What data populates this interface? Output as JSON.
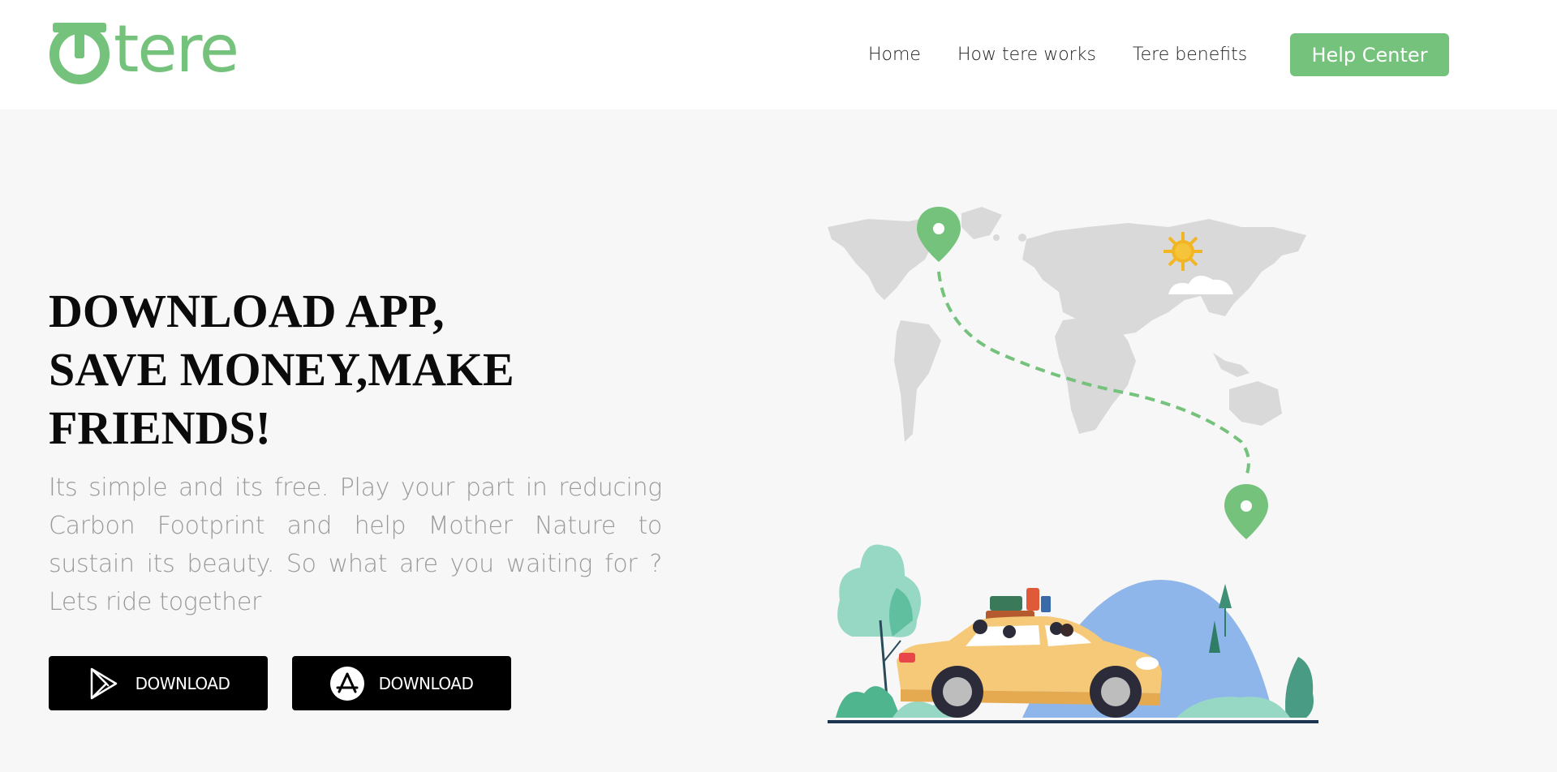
{
  "brand": {
    "name": "tere",
    "accent": "#74c27b"
  },
  "nav": {
    "items": [
      "Home",
      "How tere works",
      "Tere benefits"
    ],
    "cta": "Help Center"
  },
  "hero": {
    "title_lines": [
      "DOWNLOAD APP,",
      "SAVE MONEY,MAKE",
      "FRIENDS!"
    ],
    "description": "Its simple and its free. Play your part in reducing Carbon Footprint and help Mother Nature to sustain its beauty. So what are you waiting for ? Lets ride together"
  },
  "downloads": [
    {
      "label": "DOWNLOAD",
      "icon": "google-play-icon"
    },
    {
      "label": "DOWNLOAD",
      "icon": "app-store-icon"
    }
  ],
  "colors": {
    "background": "#f7f7f7",
    "header": "#ffffff",
    "button": "#000000",
    "map": "#d9d9d9",
    "car": "#f5c978",
    "sun": "#f2b624"
  }
}
